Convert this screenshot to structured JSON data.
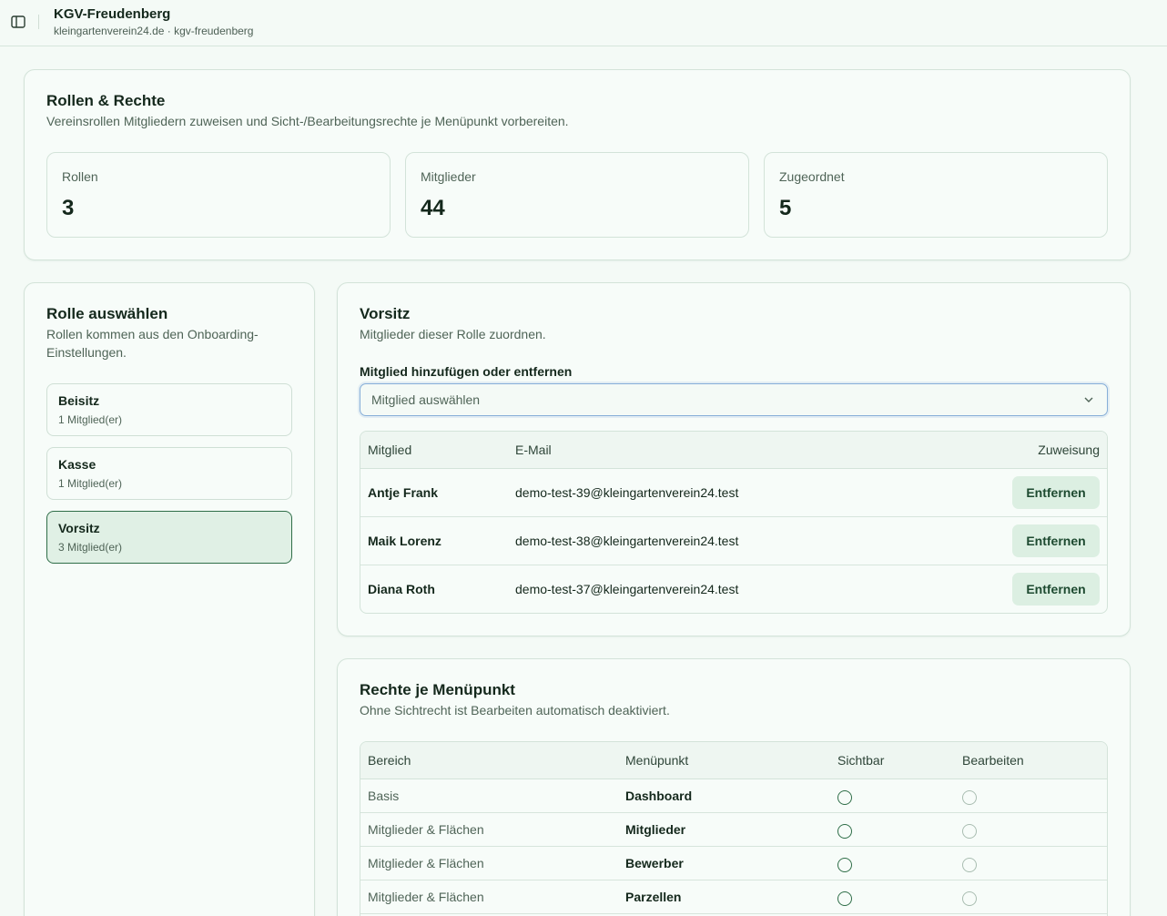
{
  "header": {
    "title": "KGV-Freudenberg",
    "subtitle": "kleingartenverein24.de · kgv-freudenberg"
  },
  "overview": {
    "title": "Rollen & Rechte",
    "description": "Vereinsrollen Mitgliedern zuweisen und Sicht-/Bearbeitungsrechte je Menüpunkt vorbereiten.",
    "stats": [
      {
        "label": "Rollen",
        "value": "3"
      },
      {
        "label": "Mitglieder",
        "value": "44"
      },
      {
        "label": "Zugeordnet",
        "value": "5"
      }
    ]
  },
  "role_select": {
    "title": "Rolle auswählen",
    "description": "Rollen kommen aus den Onboarding-Einstellungen.",
    "roles": [
      {
        "name": "Beisitz",
        "count": "1 Mitglied(er)"
      },
      {
        "name": "Kasse",
        "count": "1 Mitglied(er)"
      },
      {
        "name": "Vorsitz",
        "count": "3 Mitglied(er)"
      }
    ],
    "active_role": "Vorsitz"
  },
  "role_detail": {
    "title": "Vorsitz",
    "description": "Mitglieder dieser Rolle zuordnen.",
    "field_label": "Mitglied hinzufügen oder entfernen",
    "select_placeholder": "Mitglied auswählen",
    "columns": [
      "Mitglied",
      "E-Mail",
      "Zuweisung"
    ],
    "members": [
      {
        "name": "Antje Frank",
        "email": "demo-test-39@kleingartenverein24.test",
        "action": "Entfernen"
      },
      {
        "name": "Maik Lorenz",
        "email": "demo-test-38@kleingartenverein24.test",
        "action": "Entfernen"
      },
      {
        "name": "Diana Roth",
        "email": "demo-test-37@kleingartenverein24.test",
        "action": "Entfernen"
      }
    ]
  },
  "permissions": {
    "title": "Rechte je Menüpunkt",
    "description": "Ohne Sichtrecht ist Bearbeiten automatisch deaktiviert.",
    "columns": [
      "Bereich",
      "Menüpunkt",
      "Sichtbar",
      "Bearbeiten"
    ],
    "rows": [
      {
        "area": "Basis",
        "item": "Dashboard",
        "visible": false,
        "edit": false
      },
      {
        "area": "Mitglieder & Flächen",
        "item": "Mitglieder",
        "visible": false,
        "edit": false
      },
      {
        "area": "Mitglieder & Flächen",
        "item": "Bewerber",
        "visible": false,
        "edit": false
      },
      {
        "area": "Mitglieder & Flächen",
        "item": "Parzellen",
        "visible": false,
        "edit": false
      }
    ]
  },
  "colors": {
    "background": "#f4faf6",
    "accent": "#2f6e48",
    "button_bg": "#dcefe2"
  }
}
